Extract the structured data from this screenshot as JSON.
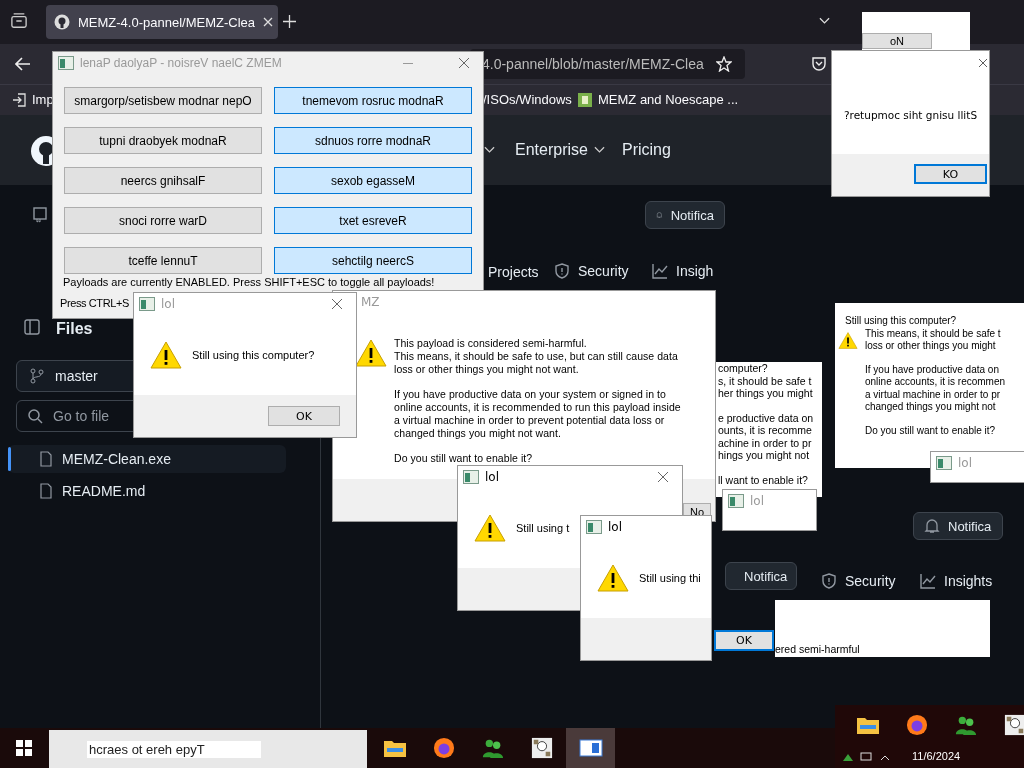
{
  "browser": {
    "tab": {
      "title": "MEMZ-4.0-pannel/MEMZ-Clea",
      "selected": true
    },
    "address": "4.0-pannel/blob/master/MEMZ-Clea",
    "bookmarks": [
      "Imp",
      "/ISOs/Windows",
      "MEMZ and Noescape ..."
    ]
  },
  "github": {
    "header_nav": [
      {
        "label": "Enterprise",
        "dropdown": true
      },
      {
        "label": "Pricing",
        "dropdown": false
      }
    ],
    "notification_buttons": [
      "Notifica",
      "Notifica",
      "Notifica"
    ],
    "repo_tabs": [
      {
        "label": "Projects",
        "kind": "plain"
      },
      {
        "label": "Security",
        "kind": "shield"
      },
      {
        "label": "Insigh",
        "kind": "chart"
      },
      {
        "label": "Security",
        "kind": "shield"
      },
      {
        "label": "Insights",
        "kind": "chart"
      }
    ],
    "sidebar": {
      "title": "Files",
      "branch": "master",
      "search_placeholder": "Go to file",
      "files": [
        {
          "name": "MEMZ-Clean.exe",
          "selected": true
        },
        {
          "name": "README.md",
          "selected": false
        }
      ]
    }
  },
  "payload_panel": {
    "title": "lenaP daolyaP - noisreV naelC ZMEM",
    "buttons": [
      {
        "label": "smargorp/setisbew modnar nepO",
        "on": false
      },
      {
        "label": "tnemevom rosruc modnaR",
        "on": true
      },
      {
        "label": "tupni draobyek modnaR",
        "on": false
      },
      {
        "label": "sdnuos rorre modnaR",
        "on": true
      },
      {
        "label": "neercs gnihsalF",
        "on": false
      },
      {
        "label": "sexob egasseM",
        "on": true
      },
      {
        "label": "snoci rorre warD",
        "on": false
      },
      {
        "label": "txet esreveR",
        "on": true
      },
      {
        "label": "tceffe lennuT",
        "on": false
      },
      {
        "label": "sehctilg neercS",
        "on": true
      }
    ],
    "status": [
      "Payloads are currently ENABLED. Press SHIFT+ESC to toggle all payloads!",
      "Press CTRL+S"
    ]
  },
  "semi_harmful_dialog": {
    "title": "MZ",
    "paragraphs": [
      "This payload is considered semi-harmful.\nThis means, it should be safe to use, but can still cause data\nloss or other things you might not want.",
      "If you have productive data on your system or signed in to\nonline accounts, it is recommended to run this payload inside\na virtual machine in order to prevent potential data loss or\nchanged things you might not want.",
      "Do you still want to enable it?"
    ],
    "button": "No"
  },
  "lol_dialogs": [
    {
      "title": "lol",
      "message": "Still using this computer?",
      "button": "OK"
    },
    {
      "title": "lol",
      "message": "Still using t"
    },
    {
      "title": "lol",
      "message": "Still using thi"
    }
  ],
  "lol_stubs": [
    {
      "title": "lol"
    },
    {
      "title": "lol"
    }
  ],
  "mirrored_dialog": {
    "fragment_button": "oN",
    "message": "?retupmoc siht gnisu llitS",
    "button": "KO"
  },
  "fragments": [
    {
      "paragraphs": [
        "computer?\ns, it should be safe t\nher things you might",
        "e productive data on\nounts, it is recomme\nachine in order to pr\nhings you might not",
        "ll want to enable it?"
      ]
    },
    {
      "paragraphs": [
        "Still using this computer?",
        "This means, it should be safe t\nloss or other things you might",
        "If you have productive data on\nonline accounts, it is recommen\na virtual machine in order to pr\nchanged things you might not",
        "Do you still want to enable it?"
      ]
    },
    {
      "paragraphs": [
        "ered semi-harmful"
      ]
    }
  ],
  "floating_ok": "OK",
  "taskbar": {
    "search_placeholder": "hcraes ot ereh epyT",
    "apps": [
      {
        "kind": "folder",
        "selected": false
      },
      {
        "kind": "firefox",
        "selected": false
      },
      {
        "kind": "people",
        "selected": false
      },
      {
        "kind": "comic",
        "selected": false
      },
      {
        "kind": "window",
        "selected": true
      }
    ],
    "tray_apps": [
      {
        "kind": "folder"
      },
      {
        "kind": "firefox"
      },
      {
        "kind": "people"
      },
      {
        "kind": "comic"
      }
    ],
    "date": "11/6/2024"
  }
}
